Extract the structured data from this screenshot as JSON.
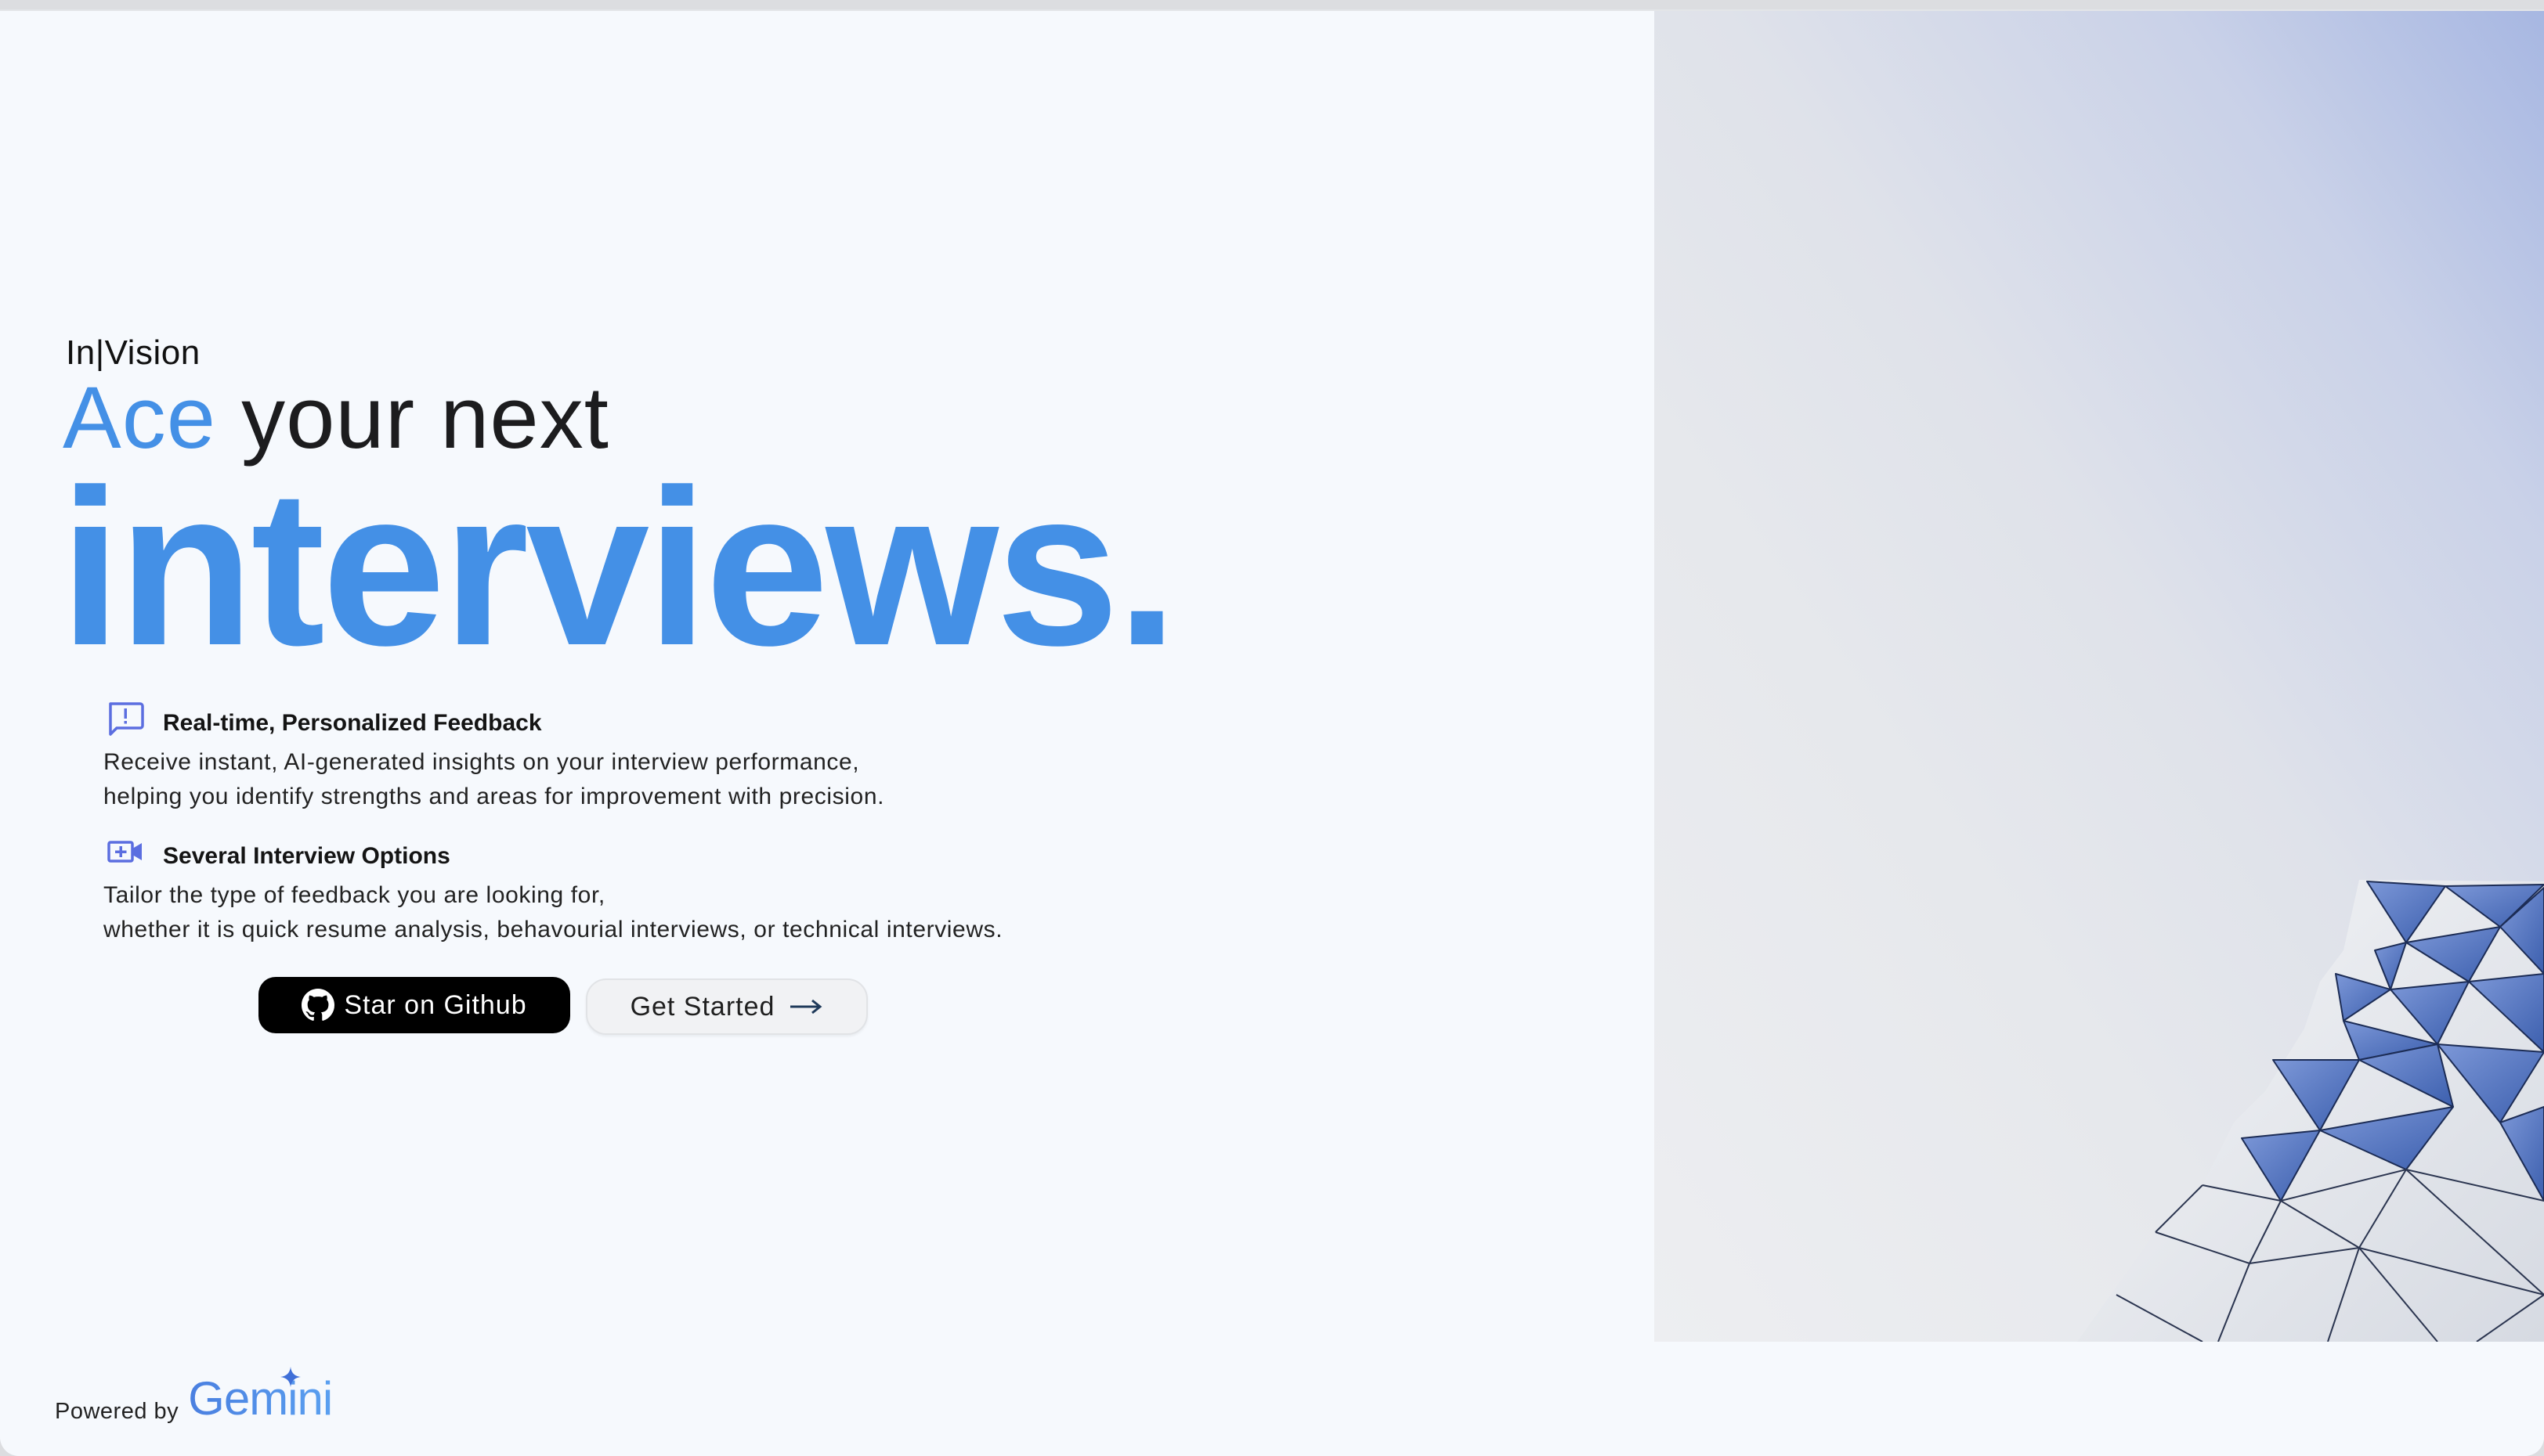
{
  "brand": "In|Vision",
  "headline": {
    "accent_word": "Ace",
    "rest": " your next",
    "big": "interviews."
  },
  "features": [
    {
      "icon": "feedback-icon",
      "title": "Real-time, Personalized Feedback",
      "desc_line1": "Receive instant, AI-generated insights on your interview performance,",
      "desc_line2": "helping you identify strengths and areas for improvement with precision."
    },
    {
      "icon": "video-call-icon",
      "title": "Several Interview Options",
      "desc_line1": "Tailor the type of feedback you are looking for,",
      "desc_line2": "whether it is quick resume analysis, behavourial interviews, or technical interviews."
    }
  ],
  "buttons": {
    "github": "Star on Github",
    "start": "Get Started"
  },
  "footer": {
    "powered_label": "Powered by",
    "logo_text": "Gemini"
  },
  "colors": {
    "accent": "#4490e6",
    "icon": "#5b6ee0",
    "background": "#f6f9fd"
  }
}
